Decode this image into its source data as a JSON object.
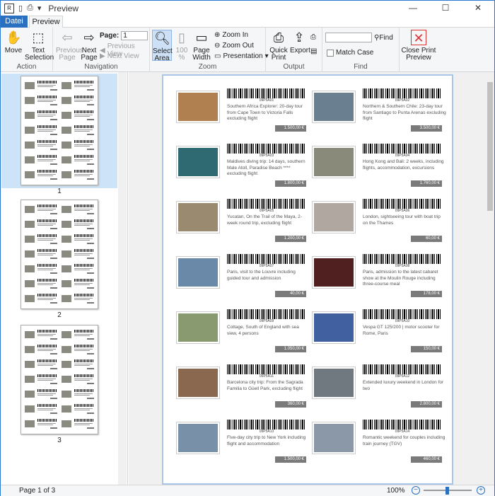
{
  "titlebar": {
    "title": "Preview",
    "app_icon": "report-icon"
  },
  "tabs": {
    "file": "Datei",
    "preview": "Preview"
  },
  "ribbon": {
    "action": {
      "label": "Action",
      "move": "Move",
      "text_selection": "Text Selection"
    },
    "navigation": {
      "label": "Navigation",
      "previous_page": "Previous Page",
      "next_page": "Next Page",
      "page_label": "Page:",
      "page_value": "1",
      "previous_view": "Previous View",
      "next_view": "Next View"
    },
    "zoom": {
      "label": "Zoom",
      "select_area": "Select Area",
      "hundred": "100 %",
      "page_width": "Page Width",
      "zoom_in": "Zoom In",
      "zoom_out": "Zoom Out",
      "presentation": "Presentation"
    },
    "output": {
      "label": "Output",
      "quick_print": "Quick Print",
      "export": "Export"
    },
    "find": {
      "label": "Find",
      "find_btn": "Find",
      "match_case": "Match Case",
      "value": ""
    },
    "close": {
      "label": "Close Print Preview"
    }
  },
  "thumbnails": [
    "1",
    "2",
    "3"
  ],
  "items": [
    {
      "desc": "Southern Africa Explorer: 20-day tour from Cape Town to Victoria Falls excluding flight",
      "price": "1.500,00 €",
      "code": "09P5A01",
      "img": "#b08050"
    },
    {
      "desc": "Northern & Southern Chile: 23-day tour from Santiago to Punta Arenas excluding flight",
      "price": "3.500,00 €",
      "code": "09P5A02",
      "img": "#6a8090"
    },
    {
      "desc": "Maldives diving trip: 14 days, southern Male Atoll, Paradise Beach **** excluding flight",
      "price": "1.800,00 €",
      "code": "09P5A03",
      "img": "#2f6a72"
    },
    {
      "desc": "Hong Kong and Bali: 2 weeks, including flights, accommodation, excursions",
      "price": "1.760,00 €",
      "code": "09P5A04",
      "img": "#8a8a7a"
    },
    {
      "desc": "Yucatan, On the Trail of the Maya, 2-week round trip, excluding flight",
      "price": "1.200,00 €",
      "code": "09P5A05",
      "img": "#9a8a70"
    },
    {
      "desc": "London, sightseeing tour with boat trip on the Thames",
      "price": "60,00 €",
      "code": "09P5A06",
      "img": "#b0a8a0"
    },
    {
      "desc": "Paris, visit to the Louvre including guided tour and admission",
      "price": "40,00 €",
      "code": "09P5A07",
      "img": "#6a88a8"
    },
    {
      "desc": "Paris, admission to the latest cabaret show at the Moulin Rouge including three-course meal",
      "price": "178,00 €",
      "code": "09P5A08",
      "img": "#502020"
    },
    {
      "desc": "Cottage, South of England with sea view, 4 persons",
      "price": "1.050,00 €",
      "code": "09P5A09",
      "img": "#8a9a70"
    },
    {
      "desc": "Vespa GT 125/200 | motor scooter for Rome, Paris",
      "price": "150,00 €",
      "code": "09P5A10",
      "img": "#4060a0"
    },
    {
      "desc": "Barcelona city trip: From the Sagrada Familia to Güell Park, excluding flight",
      "price": "360,00 €",
      "code": "09P5A11",
      "img": "#8a6850"
    },
    {
      "desc": "Extended luxury weekend in London for two",
      "price": "2.800,00 €",
      "code": "09P5A12",
      "img": "#707880"
    },
    {
      "desc": "Five-day city trip to New York including flight and accommodation",
      "price": "1.500,00 €",
      "code": "09P5A13",
      "img": "#7890a8"
    },
    {
      "desc": "Romantic weekend for couples including train journey (TGV)",
      "price": "460,00 €",
      "code": "09P5A14",
      "img": "#8a98a8"
    }
  ],
  "status": {
    "page": "Page 1 of 3",
    "zoom": "100%"
  }
}
